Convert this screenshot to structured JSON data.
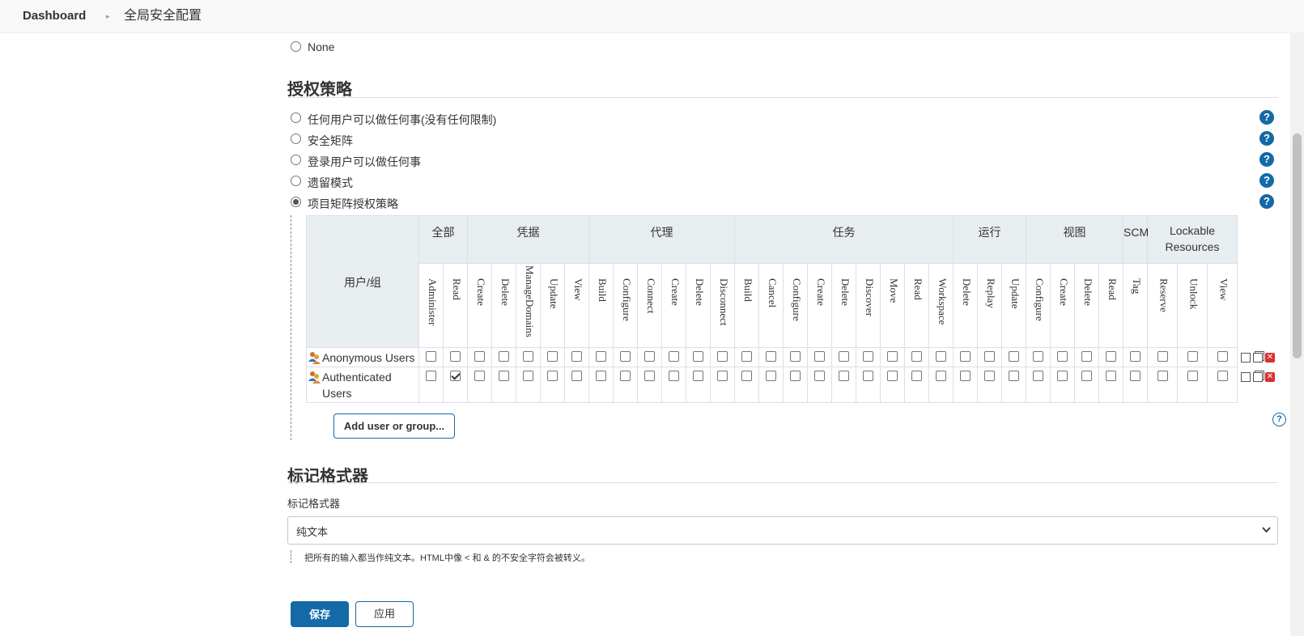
{
  "breadcrumb": {
    "home": "Dashboard",
    "separator": "▸",
    "current": "全局安全配置"
  },
  "security_realm": {
    "none_label": "None"
  },
  "authorization": {
    "title": "授权策略",
    "options": [
      {
        "label": "任何用户可以做任何事(没有任何限制)",
        "selected": false
      },
      {
        "label": "安全矩阵",
        "selected": false
      },
      {
        "label": "登录用户可以做任何事",
        "selected": false
      },
      {
        "label": "遗留模式",
        "selected": false
      },
      {
        "label": "项目矩阵授权策略",
        "selected": true
      }
    ],
    "help_icon": "?",
    "matrix": {
      "user_header": "用户/组",
      "groups": [
        "全部",
        "凭据",
        "代理",
        "任务",
        "运行",
        "视图",
        "SCM",
        "Lockable Resources"
      ],
      "permissions": [
        "Administer",
        "Read",
        "Create",
        "Delete",
        "ManageDomains",
        "Update",
        "View",
        "Build",
        "Configure",
        "Connect",
        "Create",
        "Delete",
        "Disconnect",
        "Build",
        "Cancel",
        "Configure",
        "Create",
        "Delete",
        "Discover",
        "Move",
        "Read",
        "Workspace",
        "Delete",
        "Replay",
        "Update",
        "Configure",
        "Create",
        "Delete",
        "Read",
        "Tag",
        "Reserve",
        "Unlock",
        "View"
      ],
      "rows": [
        {
          "name": "Anonymous Users",
          "checked": []
        },
        {
          "name": "Authenticated Users",
          "checked": [
            1
          ]
        }
      ],
      "add_button": "Add user or group..."
    }
  },
  "markup": {
    "title": "标记格式器",
    "field_label": "标记格式器",
    "selected_value": "纯文本",
    "description": "把所有的输入都当作纯文本。HTML中像 < 和 & 的不安全字符会被转义。"
  },
  "footer": {
    "save": "保存",
    "apply": "应用"
  },
  "colors": {
    "accent": "#1469a7",
    "header_bg": "#e8edf0"
  }
}
